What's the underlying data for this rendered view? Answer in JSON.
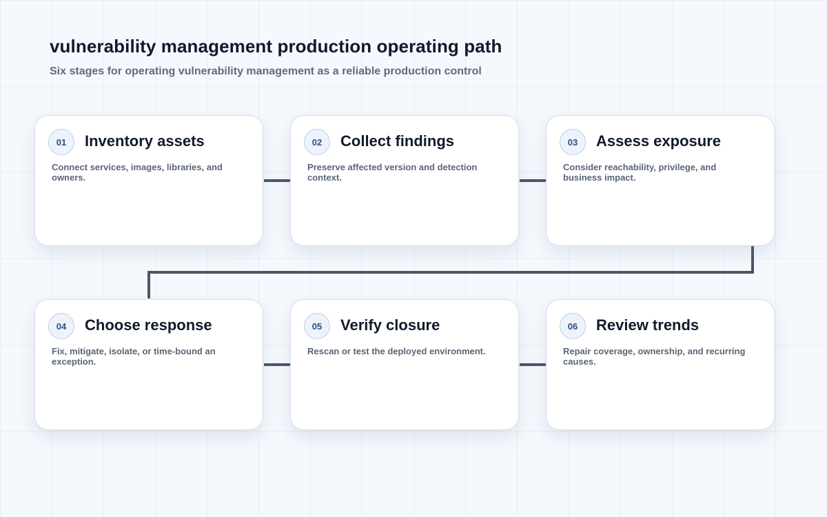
{
  "header": {
    "title": "vulnerability management production operating path",
    "subtitle": "Six stages for operating vulnerability management as a reliable production control"
  },
  "stages": [
    {
      "number": "01",
      "title": "Inventory assets",
      "description": "Connect services, images, libraries, and owners."
    },
    {
      "number": "02",
      "title": "Collect findings",
      "description": "Preserve affected version and detection context."
    },
    {
      "number": "03",
      "title": "Assess exposure",
      "description": "Consider reachability, privilege, and business impact."
    },
    {
      "number": "04",
      "title": "Choose response",
      "description": "Fix, mitigate, isolate, or time-bound an exception."
    },
    {
      "number": "05",
      "title": "Verify closure",
      "description": "Rescan or test the deployed environment."
    },
    {
      "number": "06",
      "title": "Review trends",
      "description": "Repair coverage, ownership, and recurring causes."
    }
  ]
}
